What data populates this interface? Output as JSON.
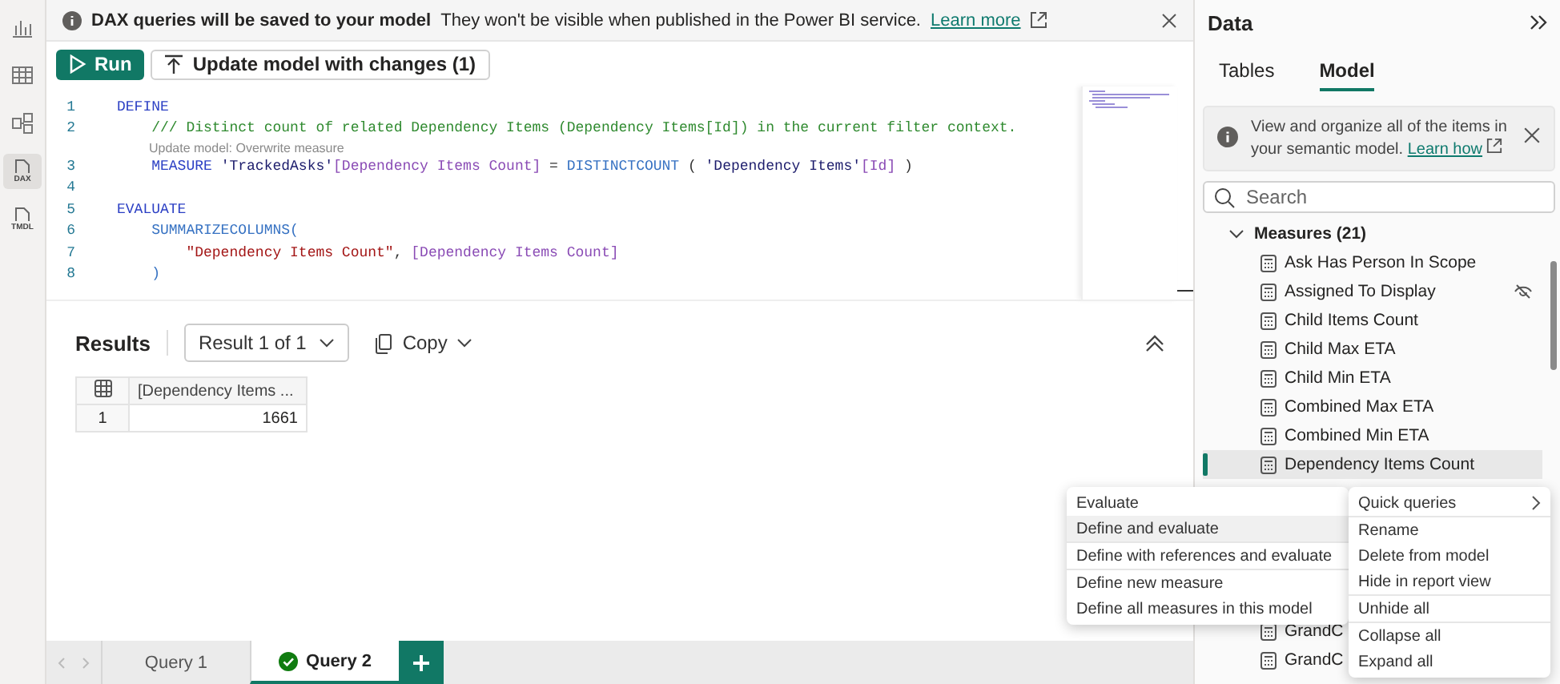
{
  "rail": [
    {
      "kind": "report",
      "selected": false
    },
    {
      "kind": "table",
      "selected": false
    },
    {
      "kind": "model",
      "selected": false
    },
    {
      "kind": "dax",
      "label": "DAX",
      "selected": true
    },
    {
      "kind": "tmdl",
      "label": "TMDL",
      "selected": false
    }
  ],
  "banner": {
    "title": "DAX queries will be saved to your model",
    "message": "They won't be visible when published in the Power BI service.",
    "link": "Learn more"
  },
  "toolbar": {
    "run": "Run",
    "update": "Update model with changes (1)"
  },
  "editor": {
    "lines": [
      {
        "kind": "code",
        "number": "1",
        "tokens": [
          {
            "kind": "keyword",
            "text": "DEFINE"
          }
        ]
      },
      {
        "kind": "code",
        "number": "2",
        "tokens": [
          {
            "kind": "comment",
            "text": "    /// Distinct count of related Dependency Items (Dependency Items[Id]) in the current filter context."
          }
        ]
      },
      {
        "kind": "lens",
        "text": "Update model: Overwrite measure"
      },
      {
        "kind": "code",
        "number": "3",
        "tokens": [
          {
            "kind": "keyword",
            "text": "    MEASURE "
          },
          {
            "kind": "table",
            "text": "'TrackedAsks'"
          },
          {
            "kind": "measure",
            "text": "[Dependency Items Count]"
          },
          {
            "kind": "plain",
            "text": " = "
          },
          {
            "kind": "function",
            "text": "DISTINCTCOUNT"
          },
          {
            "kind": "plain",
            "text": " ( "
          },
          {
            "kind": "table",
            "text": "'Dependency Items'"
          },
          {
            "kind": "measure",
            "text": "[Id]"
          },
          {
            "kind": "plain",
            "text": " )"
          }
        ]
      },
      {
        "kind": "code",
        "number": "4"
      },
      {
        "kind": "code",
        "number": "5",
        "tokens": [
          {
            "kind": "keyword",
            "text": "EVALUATE"
          }
        ]
      },
      {
        "kind": "code",
        "number": "6",
        "tokens": [
          {
            "kind": "function",
            "text": "    SUMMARIZECOLUMNS("
          }
        ]
      },
      {
        "kind": "code",
        "number": "7",
        "tokens": [
          {
            "kind": "string",
            "text": "        \"Dependency Items Count\""
          },
          {
            "kind": "plain",
            "text": ", "
          },
          {
            "kind": "measure",
            "text": "[Dependency Items Count]"
          }
        ]
      },
      {
        "kind": "code",
        "number": "8",
        "tokens": [
          {
            "kind": "function",
            "text": "    )"
          }
        ]
      }
    ]
  },
  "results": {
    "title": "Results",
    "picker": "Result 1 of 1",
    "copy": "Copy",
    "columns": [
      "[Dependency Items ..."
    ],
    "rows": [
      {
        "number": "1",
        "cells": [
          "1661"
        ]
      }
    ]
  },
  "query_tabs": [
    {
      "label": "Query 1",
      "selected": false,
      "ok": false
    },
    {
      "label": "Query 2",
      "selected": true,
      "ok": true
    }
  ],
  "data_pane": {
    "title": "Data",
    "tabs": [
      {
        "label": "Tables",
        "selected": false
      },
      {
        "label": "Model",
        "selected": true
      }
    ],
    "info": {
      "text": "View and organize all of the items in your semantic model.",
      "link": "Learn how"
    },
    "search": {
      "placeholder": "Search"
    },
    "tree": [
      {
        "label": "Measures (21)",
        "expanded": true,
        "children": [
          {
            "label": "Ask Has Person In Scope",
            "hidden": false,
            "selected": false
          },
          {
            "label": "Assigned To Display",
            "hidden": true,
            "selected": false
          },
          {
            "label": "Child Items Count",
            "hidden": false,
            "selected": false
          },
          {
            "label": "Child Max ETA",
            "hidden": false,
            "selected": false
          },
          {
            "label": "Child Min ETA",
            "hidden": false,
            "selected": false
          },
          {
            "label": "Combined Max ETA",
            "hidden": false,
            "selected": false
          },
          {
            "label": "Combined Min ETA",
            "hidden": false,
            "selected": false
          },
          {
            "label": "Dependency Items Count",
            "hidden": false,
            "selected": true
          },
          {
            "label": "GrandC",
            "hidden": false,
            "selected": false
          },
          {
            "label": "GrandC",
            "hidden": false,
            "selected": false
          }
        ]
      }
    ]
  },
  "context_menu": {
    "items": [
      {
        "label": "Quick queries",
        "kind": "submenu",
        "separator": false
      },
      {
        "label": "Rename",
        "kind": "item",
        "separator": true
      },
      {
        "label": "Delete from model",
        "kind": "item",
        "separator": false
      },
      {
        "label": "Hide in report view",
        "kind": "item",
        "separator": false
      },
      {
        "label": "Unhide all",
        "kind": "item",
        "separator": true
      },
      {
        "label": "Collapse all",
        "kind": "item",
        "separator": true
      },
      {
        "label": "Expand all",
        "kind": "item",
        "separator": false
      }
    ]
  },
  "submenu": {
    "items": [
      {
        "label": "Evaluate",
        "selected": false,
        "separator": false
      },
      {
        "label": "Define and evaluate",
        "selected": true,
        "separator": false
      },
      {
        "label": "Define with references and evaluate",
        "selected": false,
        "separator": true
      },
      {
        "label": "Define new measure",
        "selected": false,
        "separator": true
      },
      {
        "label": "Define all measures in this model",
        "selected": false,
        "separator": false
      }
    ]
  }
}
